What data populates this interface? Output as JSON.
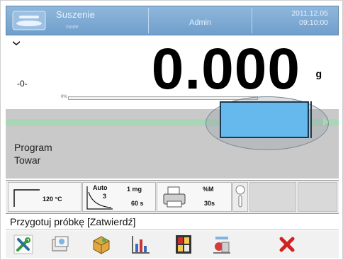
{
  "header": {
    "mode_title": "Suszenie",
    "mode_subtitle": "mode",
    "user": "Admin",
    "date": "2011.12.05",
    "time": "09:10:00"
  },
  "weight": {
    "value": "0.000",
    "unit": "g",
    "zero_indicator": "-0-",
    "progress_label": "0%",
    "progress_fraction": 0.0
  },
  "info": {
    "lines": [
      "Program",
      "Towar"
    ]
  },
  "params": {
    "temperature": "120 °C",
    "auto_label": "Auto",
    "auto_value": "3",
    "resolution": "1 mg",
    "interval": "60 s",
    "percent_label": "%M",
    "percent_interval": "30s"
  },
  "prompt": {
    "text": "Przygotuj próbkę [Zatwierdź]"
  },
  "toolbar": {
    "icons": [
      "tools-icon",
      "database-icon",
      "product-icon",
      "chart-icon",
      "display-modes-icon",
      "scale-settings-icon",
      "close-icon"
    ]
  },
  "colors": {
    "header_bg": "#7aa9d4",
    "bar_green": "#a9d6b7",
    "target_blue": "#66b9ec",
    "close_red": "#d32020"
  }
}
